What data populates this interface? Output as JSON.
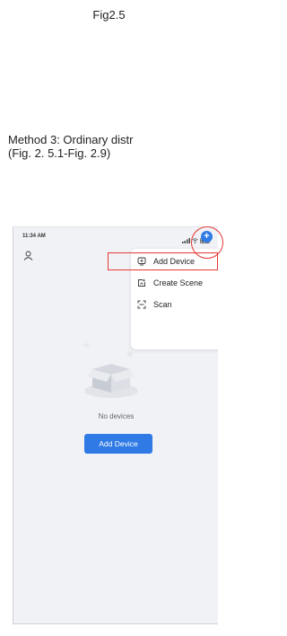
{
  "doc": {
    "caption": "Fig2.5",
    "method_line1": "Method 3: Ordinary distr",
    "method_line2": "(Fig. 2. 5.1-Fig. 2.9)"
  },
  "status_bar": {
    "time": "11:34 AM"
  },
  "menu": {
    "items": [
      {
        "label": "Add Device",
        "icon": "add-device-icon"
      },
      {
        "label": "Create Scene",
        "icon": "create-scene-icon"
      },
      {
        "label": "Scan",
        "icon": "scan-icon"
      }
    ]
  },
  "empty_state": {
    "message": "No devices",
    "button_label": "Add Device"
  },
  "colors": {
    "accent": "#2f7ae5",
    "highlight": "#e53935",
    "background": "#f1f2f6"
  }
}
